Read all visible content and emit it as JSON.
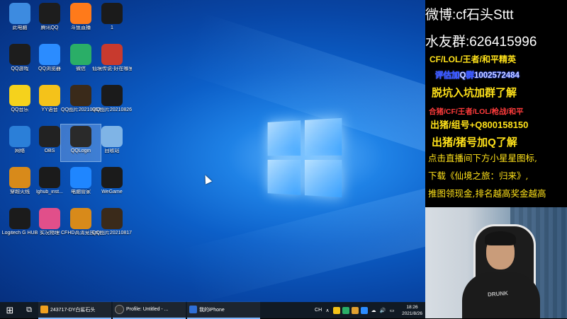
{
  "desktop": {
    "icons": [
      {
        "label": "此电脑",
        "icon": "computer-icon",
        "color": "#3d8be0"
      },
      {
        "label": "腾讯QQ",
        "icon": "qq-penguin-icon",
        "color": "#1d1d1d"
      },
      {
        "label": "斗鱼直播",
        "icon": "douyu-icon",
        "color": "#ff7a1a"
      },
      {
        "label": "1",
        "icon": "image-file-icon",
        "color": "#1b1b1b"
      },
      {
        "label": "QQ游戏",
        "icon": "qq-game-icon",
        "color": "#1d1d1d"
      },
      {
        "label": "QQ浏览器",
        "icon": "qq-browser-icon",
        "color": "#2b8cff"
      },
      {
        "label": "微信",
        "icon": "wechat-icon",
        "color": "#2aae67"
      },
      {
        "label": "仙境传说-好在哪里",
        "icon": "game-icon",
        "color": "#c83a2e"
      },
      {
        "label": "QQ音乐",
        "icon": "qq-music-icon",
        "color": "#f5d21c"
      },
      {
        "label": "YY语音",
        "icon": "yy-icon",
        "color": "#f4c21a"
      },
      {
        "label": "QQ图片20210802...",
        "icon": "image-file-icon",
        "color": "#3a2a1a"
      },
      {
        "label": "QQ图片20210826...",
        "icon": "image-file-icon",
        "color": "#1b1b1b"
      },
      {
        "label": "网络",
        "icon": "network-icon",
        "color": "#2b7fd8"
      },
      {
        "label": "OBS",
        "icon": "obs-icon",
        "color": "#222222"
      },
      {
        "label": "QQLogin",
        "icon": "cf-logo-icon",
        "color": "#2a2a2a"
      },
      {
        "label": "回收站",
        "icon": "recycle-bin-icon",
        "color": "#7fb4e6"
      },
      {
        "label": "穿越火线",
        "icon": "crossfire-icon",
        "color": "#d88a1a"
      },
      {
        "label": "lghub_inst...",
        "icon": "logitech-icon",
        "color": "#1b1b1b"
      },
      {
        "label": "电脑管家",
        "icon": "shield-icon",
        "color": "#1f86ff"
      },
      {
        "label": "WeGame",
        "icon": "wegame-icon",
        "color": "#1b1b1b"
      },
      {
        "label": "Logitech G HUB",
        "icon": "logitech-icon",
        "color": "#1b1b1b"
      },
      {
        "label": "实况物理",
        "icon": "colorful-app-icon",
        "color": "#e14f8a"
      },
      {
        "label": "CFHD高清竞技大区",
        "icon": "crossfire-icon",
        "color": "#d88a1a"
      },
      {
        "label": "QQ图片20210817...",
        "icon": "image-file-icon",
        "color": "#3a2a1a"
      }
    ]
  },
  "taskbar": {
    "start_label": "⊞",
    "taskview_label": "⧉",
    "tasks": [
      {
        "label": "243717-DY白鲨石头",
        "color": "#f0a020"
      },
      {
        "label": "Profile: Untitled - ...",
        "color": "#333333"
      },
      {
        "label": "我的iPhone",
        "color": "#2f6fd6"
      }
    ],
    "tray": [
      "CH",
      "∧",
      "●",
      "●",
      "●",
      "●",
      "☁",
      "🔊",
      "▭"
    ],
    "time": "18:26",
    "date": "2021/8/26"
  },
  "overlay": {
    "line1": "微博:cf石头Sttt",
    "line2": "水友群:626415996",
    "line3": "CF/LOL/王者/和平精英",
    "line4": "评估加Q群1002572484",
    "line5": "脱坑入坑加群了解",
    "line6": "合猪/CF/王者/LOL/枪战/和平",
    "line7": "出猪/组号+Q800158150",
    "line8": "出猪/猪号加Q了解",
    "line9": "点击直播间下方小星星图标,",
    "line10": "下载《仙境之旅：归来》,",
    "line11": "推图领现金,排名越高奖金越高"
  },
  "webcam": {
    "shirt_text": "DRUNK"
  }
}
